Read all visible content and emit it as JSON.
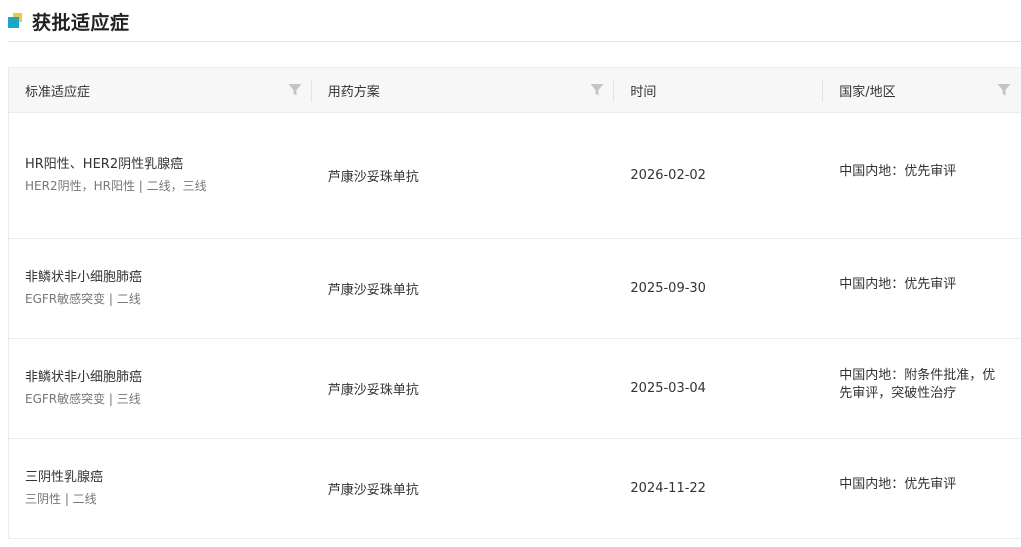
{
  "section": {
    "title": "获批适应症"
  },
  "columns": {
    "indication": "标准适应症",
    "regimen": "用药方案",
    "time": "时间",
    "region": "国家/地区"
  },
  "rows": [
    {
      "indication": "HR阳性、HER2阴性乳腺癌",
      "detail": "HER2阴性，HR阳性 | 二线，三线",
      "regimen": "芦康沙妥珠单抗",
      "date": "2026-02-02",
      "region": "中国内地：优先审评"
    },
    {
      "indication": "非鳞状非小细胞肺癌",
      "detail": "EGFR敏感突变 | 二线",
      "regimen": "芦康沙妥珠单抗",
      "date": "2025-09-30",
      "region": "中国内地：优先审评"
    },
    {
      "indication": "非鳞状非小细胞肺癌",
      "detail": "EGFR敏感突变 | 三线",
      "regimen": "芦康沙妥珠单抗",
      "date": "2025-03-04",
      "region": "中国内地：附条件批准，优先审评，突破性治疗"
    },
    {
      "indication": "三阴性乳腺癌",
      "detail": "三阴性 | 二线",
      "regimen": "芦康沙妥珠单抗",
      "date": "2024-11-22",
      "region": "中国内地：优先审评"
    }
  ],
  "colors": {
    "accent_teal": "#1aa7c7",
    "accent_yellow": "#f2c744",
    "header_bg": "#f7f7f7"
  },
  "icons": {
    "logo": "section-logo-icon",
    "filter": "filter-icon"
  }
}
